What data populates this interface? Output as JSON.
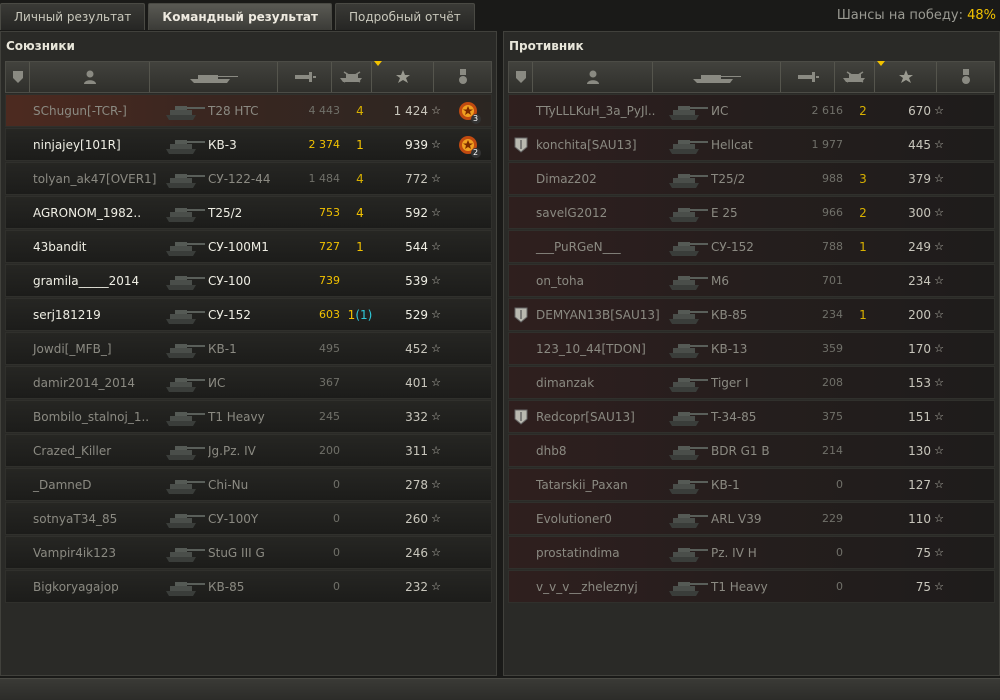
{
  "tabs": [
    "Личный результат",
    "Командный результат",
    "Подробный отчёт"
  ],
  "chance": {
    "label": "Шансы на победу:",
    "value": "48%"
  },
  "colors": {
    "accent": "#f2c200",
    "assist": "#2fc8d8",
    "self_row": "#4d2a20"
  },
  "allies": {
    "title": "Союзники",
    "rows": [
      {
        "player": "SChugun[-TCR-]",
        "tank": "T28 HTC",
        "dmg": "4 443",
        "kills": "4",
        "xp": "1 424",
        "medal": "3",
        "alive": false,
        "self": true
      },
      {
        "player": "ninjajey[101R]",
        "tank": "КВ-3",
        "dmg": "2 374",
        "kills": "1",
        "xp": "939",
        "medal": "2",
        "alive": true
      },
      {
        "player": "tolyan_ak47[OVER1]",
        "tank": "СУ-122-44",
        "dmg": "1 484",
        "kills": "4",
        "xp": "772",
        "alive": false
      },
      {
        "player": "AGRONOM_1982..",
        "tank": "T25/2",
        "dmg": "753",
        "kills": "4",
        "xp": "592",
        "alive": true
      },
      {
        "player": "43bandit",
        "tank": "СУ-100М1",
        "dmg": "727",
        "kills": "1",
        "xp": "544",
        "alive": true
      },
      {
        "player": "gramila_____2014",
        "tank": "СУ-100",
        "dmg": "739",
        "kills": "",
        "xp": "539",
        "alive": true
      },
      {
        "player": "serj181219",
        "tank": "СУ-152",
        "dmg": "603",
        "kills": "1",
        "kills_assist": "(1)",
        "xp": "529",
        "alive": true
      },
      {
        "player": "Jowdi[_MFB_]",
        "tank": "КВ-1",
        "dmg": "495",
        "kills": "",
        "xp": "452",
        "alive": false
      },
      {
        "player": "damir2014_2014",
        "tank": "ИС",
        "dmg": "367",
        "kills": "",
        "xp": "401",
        "alive": false
      },
      {
        "player": "Bombilo_stalnoj_1..",
        "tank": "T1 Heavy",
        "dmg": "245",
        "kills": "",
        "xp": "332",
        "alive": false
      },
      {
        "player": "Crazed_Killer",
        "tank": "Jg.Pz. IV",
        "dmg": "200",
        "kills": "",
        "xp": "311",
        "alive": false
      },
      {
        "player": "_DamneD",
        "tank": "Chi-Nu",
        "dmg": "0",
        "kills": "",
        "xp": "278",
        "alive": false
      },
      {
        "player": "sotnyaT34_85",
        "tank": "СУ-100Y",
        "dmg": "0",
        "kills": "",
        "xp": "260",
        "alive": false
      },
      {
        "player": "Vampir4ik123",
        "tank": "StuG III G",
        "dmg": "0",
        "kills": "",
        "xp": "246",
        "alive": false
      },
      {
        "player": "Bigkoryagajop",
        "tank": "КВ-85",
        "dmg": "0",
        "kills": "",
        "xp": "232",
        "alive": false
      }
    ]
  },
  "enemies": {
    "title": "Противник",
    "rows": [
      {
        "player": "TTyLLLKuH_3a_PyJl..",
        "tank": "ИС",
        "dmg": "2 616",
        "kills": "2",
        "xp": "670",
        "alive": false
      },
      {
        "player": "konchita[SAU13]",
        "tank": "Hellcat",
        "dmg": "1 977",
        "kills": "",
        "xp": "445",
        "alive": false,
        "clan": true
      },
      {
        "player": "Dimaz202",
        "tank": "T25/2",
        "dmg": "988",
        "kills": "3",
        "xp": "379",
        "alive": false
      },
      {
        "player": "savelG2012",
        "tank": "E 25",
        "dmg": "966",
        "kills": "2",
        "xp": "300",
        "alive": false
      },
      {
        "player": "___PuRGeN___",
        "tank": "СУ-152",
        "dmg": "788",
        "kills": "1",
        "xp": "249",
        "alive": false
      },
      {
        "player": "on_toha",
        "tank": "M6",
        "dmg": "701",
        "kills": "",
        "xp": "234",
        "alive": false
      },
      {
        "player": "DEMYAN13B[SAU13]",
        "tank": "КВ-85",
        "dmg": "234",
        "kills": "1",
        "xp": "200",
        "alive": false,
        "clan": true
      },
      {
        "player": "123_10_44[TDON]",
        "tank": "КВ-13",
        "dmg": "359",
        "kills": "",
        "xp": "170",
        "alive": false
      },
      {
        "player": "dimanzak",
        "tank": "Tiger I",
        "dmg": "208",
        "kills": "",
        "xp": "153",
        "alive": false
      },
      {
        "player": "Redcopr[SAU13]",
        "tank": "T-34-85",
        "dmg": "375",
        "kills": "",
        "xp": "151",
        "alive": false,
        "clan": true
      },
      {
        "player": "dhb8",
        "tank": "BDR G1 B",
        "dmg": "214",
        "kills": "",
        "xp": "130",
        "alive": false
      },
      {
        "player": "Tatarskii_Paxan",
        "tank": "КВ-1",
        "dmg": "0",
        "kills": "",
        "xp": "127",
        "alive": false
      },
      {
        "player": "Evolutioner0",
        "tank": "ARL V39",
        "dmg": "229",
        "kills": "",
        "xp": "110",
        "alive": false
      },
      {
        "player": "prostatindima",
        "tank": "Pz. IV H",
        "dmg": "0",
        "kills": "",
        "xp": "75",
        "alive": false
      },
      {
        "player": "v_v_v__zheleznyj",
        "tank": "T1 Heavy",
        "dmg": "0",
        "kills": "",
        "xp": "75",
        "alive": false
      }
    ]
  },
  "icons": {
    "squad": "squad-icon",
    "player": "player-icon",
    "tank": "tank-icon",
    "damage": "damage-icon",
    "kills": "kills-icon",
    "xp": "xp-star-icon",
    "medal": "medal-icon",
    "clan": "clan-badge-icon"
  }
}
